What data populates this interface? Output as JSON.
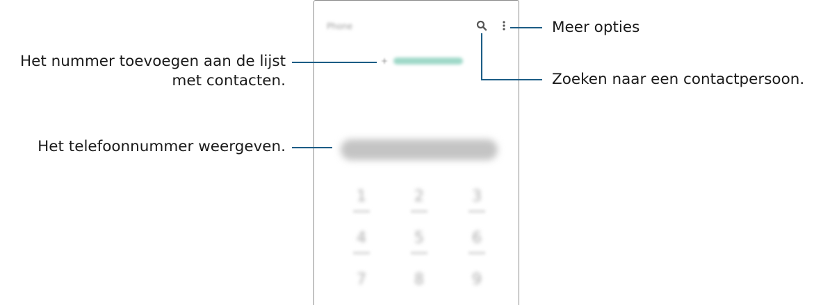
{
  "callouts": {
    "more_options": "Meer opties",
    "add_contact_line1": "Het nummer toevoegen aan de lijst",
    "add_contact_line2": "met contacten.",
    "search_contact": "Zoeken naar een contactpersoon.",
    "show_number": "Het telefoonnummer weergeven."
  },
  "phone": {
    "title": "Phone",
    "add_contact_plus": "+",
    "keypad": [
      "1",
      "2",
      "3",
      "4",
      "5",
      "6",
      "7",
      "8",
      "9"
    ]
  },
  "colors": {
    "callout_line": "#1b5c85",
    "add_contact_accent": "#9ed8c8",
    "text": "#1a1a1a"
  },
  "icons": {
    "search": "search-icon",
    "more": "more-options-icon"
  }
}
